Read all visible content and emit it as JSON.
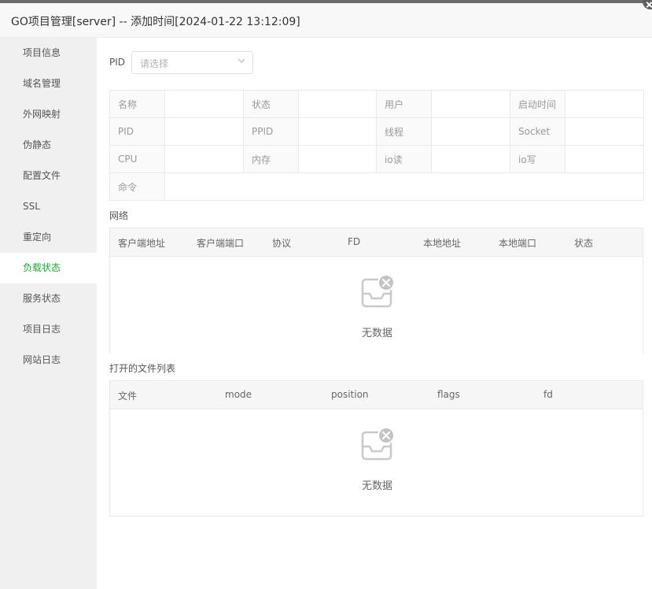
{
  "window": {
    "title": "GO项目管理[server] -- 添加时间[2024-01-22 13:12:09]"
  },
  "sidebar": {
    "items": [
      {
        "label": "项目信息"
      },
      {
        "label": "域名管理"
      },
      {
        "label": "外网映射"
      },
      {
        "label": "伪静态"
      },
      {
        "label": "配置文件"
      },
      {
        "label": "SSL"
      },
      {
        "label": "重定向"
      },
      {
        "label": "负载状态",
        "active": true
      },
      {
        "label": "服务状态"
      },
      {
        "label": "项目日志"
      },
      {
        "label": "网站日志"
      }
    ]
  },
  "pid": {
    "label": "PID",
    "placeholder": "请选择"
  },
  "info": {
    "rows": [
      [
        {
          "k": "名称",
          "v": ""
        },
        {
          "k": "状态",
          "v": ""
        },
        {
          "k": "用户",
          "v": ""
        },
        {
          "k": "启动时间",
          "v": ""
        }
      ],
      [
        {
          "k": "PID",
          "v": ""
        },
        {
          "k": "PPID",
          "v": ""
        },
        {
          "k": "线程",
          "v": ""
        },
        {
          "k": "Socket",
          "v": ""
        }
      ],
      [
        {
          "k": "CPU",
          "v": ""
        },
        {
          "k": "内存",
          "v": ""
        },
        {
          "k": "io读",
          "v": ""
        },
        {
          "k": "io写",
          "v": ""
        }
      ]
    ],
    "command_label": "命令",
    "command_value": ""
  },
  "network": {
    "title": "网络",
    "columns": [
      "客户端地址",
      "客户端端口",
      "协议",
      "FD",
      "本地地址",
      "本地端口",
      "状态"
    ],
    "empty_text": "无数据"
  },
  "files": {
    "title": "打开的文件列表",
    "columns": [
      "文件",
      "mode",
      "position",
      "flags",
      "fd"
    ],
    "empty_text": "无数据"
  },
  "colors": {
    "accent": "#20a53a",
    "sidebar_bg": "#f0f0f0",
    "header_bg": "#f8f8f8",
    "border": "#e9e9e9"
  },
  "icons": {
    "close": "close-icon",
    "chevron": "chevron-down-icon",
    "empty": "empty-inbox-icon"
  }
}
